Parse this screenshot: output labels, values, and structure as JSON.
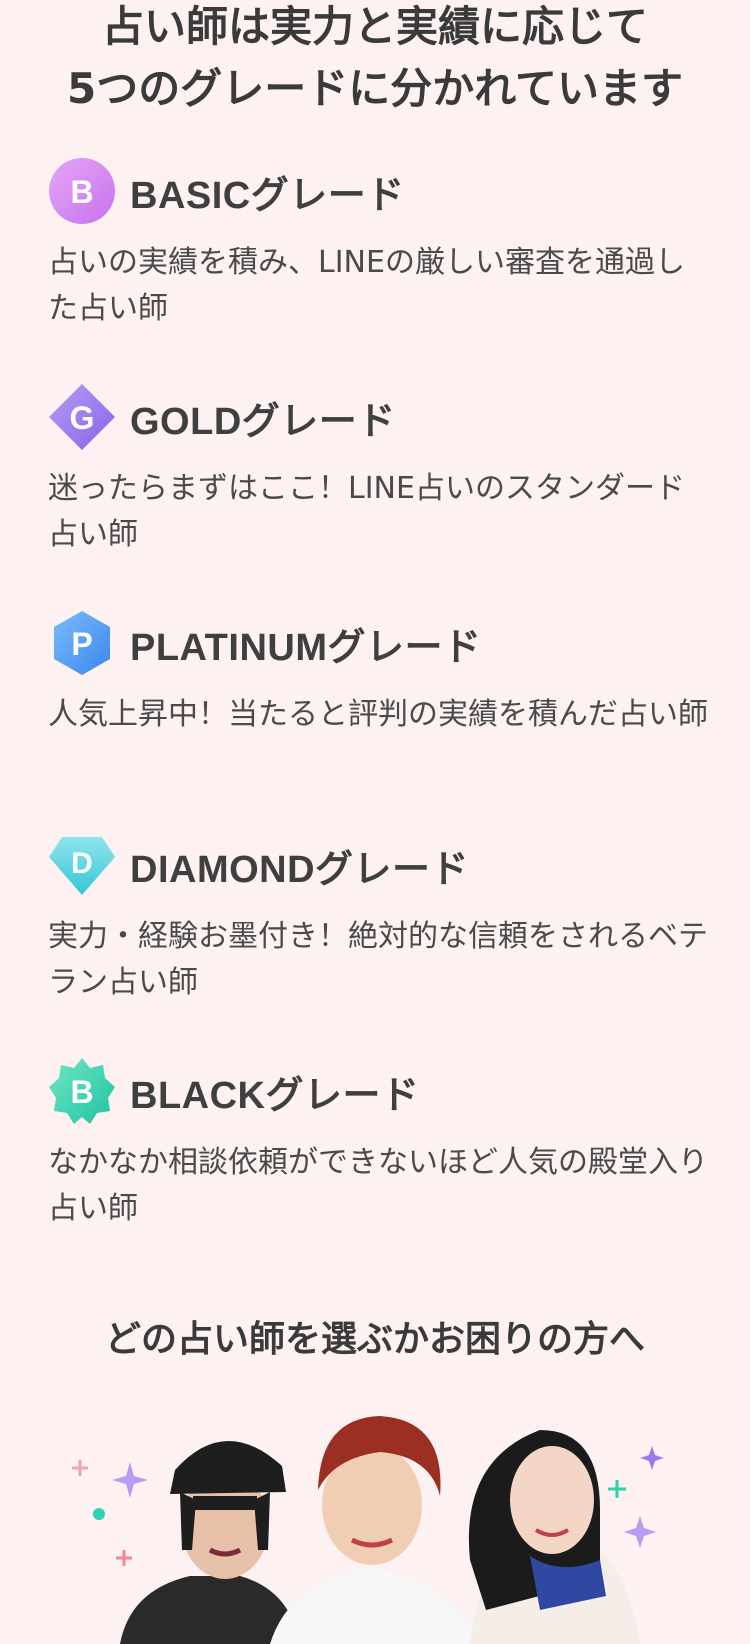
{
  "headline": {
    "line1": "占い師は実力と実績に応じて",
    "line2": "5つのグレードに分かれています"
  },
  "grades": [
    {
      "letter": "B",
      "title": "BASICグレード",
      "desc": "占いの実績を積み、LINEの厳しい審査を通過した占い師",
      "color": "#d98bf0",
      "shape": "circle"
    },
    {
      "letter": "G",
      "title": "GOLDグレード",
      "desc": "迷ったらまずはここ！LINE占いのスタンダード占い師",
      "color": "#9b7af0",
      "shape": "diamond"
    },
    {
      "letter": "P",
      "title": "PLATINUMグレード",
      "desc": "人気上昇中！当たると評判の実績を積んだ占い師",
      "color": "#4a9ef5",
      "shape": "hexagon"
    },
    {
      "letter": "D",
      "title": "DIAMONDグレード",
      "desc": "実力・経験お墨付き！絶対的な信頼をされるベテラン占い師",
      "color": "#4fd4e0",
      "shape": "gem"
    },
    {
      "letter": "B",
      "title": "BLACKグレード",
      "desc": "なかなか相談依頼ができないほど人気の殿堂入り占い師",
      "color": "#2fd1b0",
      "shape": "star"
    }
  ],
  "sub_headline": "どの占い師を選ぶかお困りの方へ"
}
